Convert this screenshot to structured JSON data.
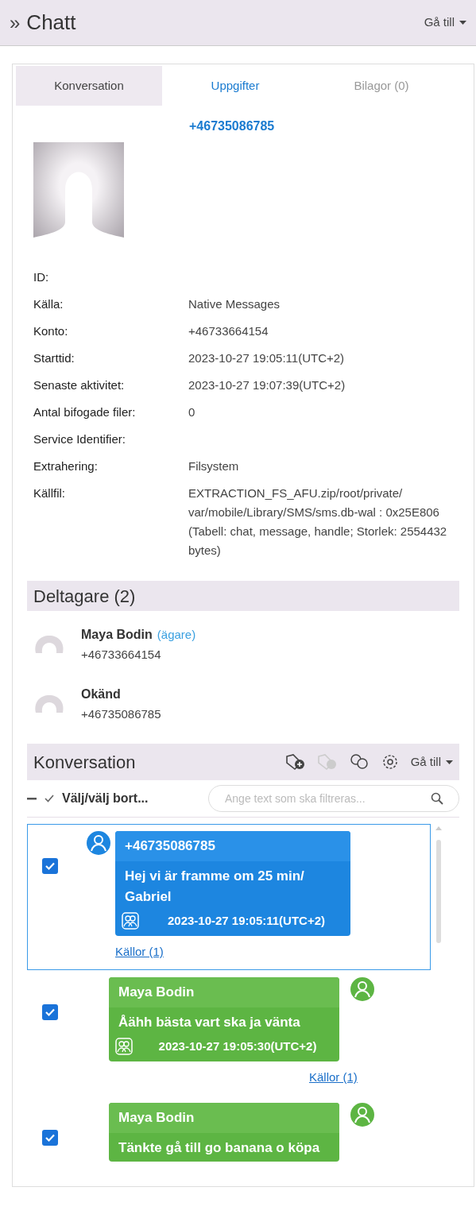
{
  "header": {
    "expand_icon": "»",
    "title": "Chatt",
    "goto": "Gå till"
  },
  "tabs": [
    {
      "label": "Konversation",
      "selected": true,
      "disabled": false
    },
    {
      "label": "Uppgifter",
      "selected": false,
      "disabled": false
    },
    {
      "label": "Bilagor (0)",
      "selected": false,
      "disabled": true
    }
  ],
  "contact": {
    "name": "+46735086785"
  },
  "details": [
    {
      "label": "ID:"
    },
    {
      "label": "Källa:",
      "value": "Native Messages"
    },
    {
      "label": "Konto:",
      "value": "+46733664154"
    },
    {
      "label": "Starttid:",
      "value": "2023-10-27 19:05:11(UTC+2)"
    },
    {
      "label": "Senaste aktivitet:",
      "value": "2023-10-27 19:07:39(UTC+2)"
    },
    {
      "label": "Antal bifogade filer:",
      "value": "0"
    },
    {
      "label": "Service Identifier:"
    },
    {
      "label": "Extrahering:",
      "value": "Filsystem"
    },
    {
      "label": "Källfil:",
      "value": "EXTRACTION_FS_AFU.zip/root/private/ var/mobile/Library/SMS/sms.db-wal : 0x25E806 (Tabell: chat, message, handle; Storlek: 2554432 bytes)"
    }
  ],
  "participants": {
    "title": "Deltagare (2)",
    "items": [
      {
        "name": "Maya Bodin",
        "role": "(ägare)",
        "phone": "+46733664154"
      },
      {
        "name": "Okänd",
        "phone": "+46735086785"
      }
    ]
  },
  "conversation": {
    "title": "Konversation",
    "goto": "Gå till",
    "select_label": "Välj/välj bort...",
    "filter": {
      "placeholder": "Ange text som ska filtreras..."
    },
    "messages": [
      {
        "kind": "incoming",
        "selected": true,
        "checked": true,
        "sender": "+46735086785",
        "text": "Hej vi är framme om 25 min/ Gabriel",
        "time": "2023-10-27 19:05:11(UTC+2)",
        "sources": "Källor (1)"
      },
      {
        "kind": "outgoing",
        "selected": false,
        "checked": true,
        "sender": "Maya Bodin",
        "text": "Åähh bästa vart ska ja vänta",
        "time": "2023-10-27 19:05:30(UTC+2)",
        "sources": "Källor (1)"
      },
      {
        "kind": "outgoing",
        "selected": false,
        "checked": true,
        "sender": "Maya Bodin",
        "text": "Tänkte gå till go banana o köpa"
      }
    ]
  }
}
